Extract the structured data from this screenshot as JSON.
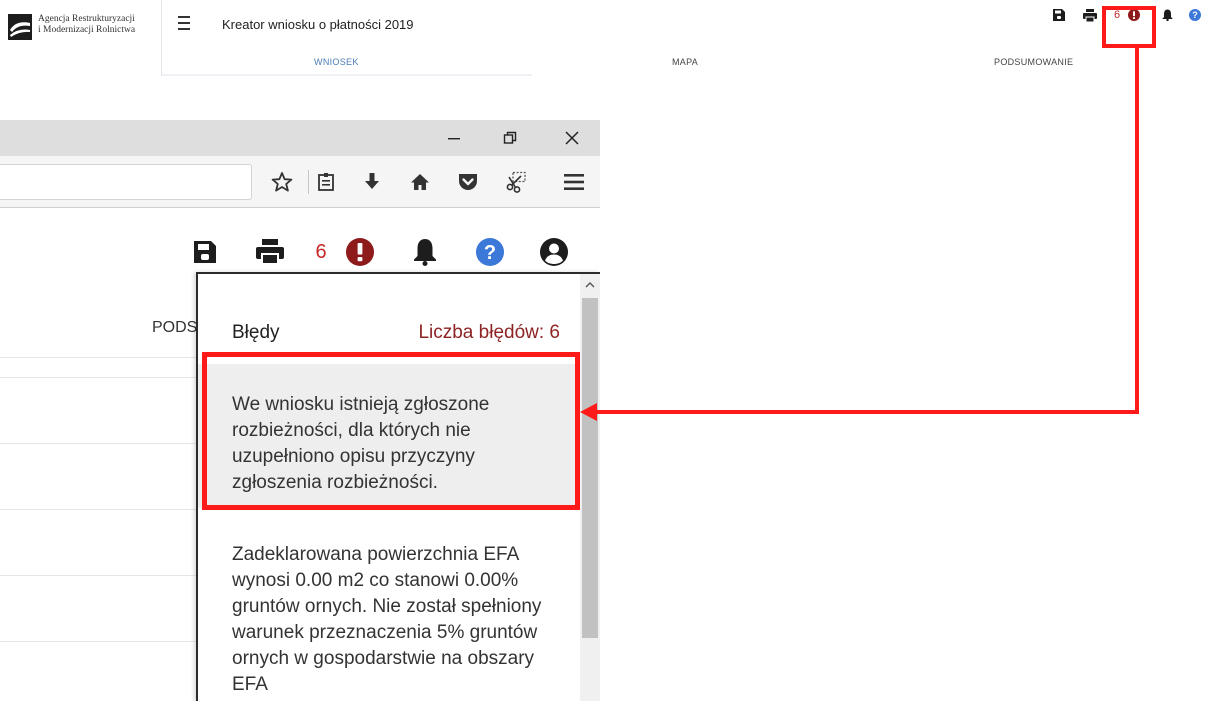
{
  "header": {
    "logo_line1": "Agencja Restrukturyzacji",
    "logo_line2": "i Modernizacji Rolnictwa",
    "title": "Kreator wniosku o płatności 2019",
    "error_count": "6",
    "tabs": [
      {
        "label": "WNIOSEK",
        "active": true
      },
      {
        "label": "MAPA",
        "active": false
      },
      {
        "label": "PODSUMOWANIE",
        "active": false
      }
    ]
  },
  "zoom": {
    "error_count": "6",
    "tab_partial": "PODS",
    "panel": {
      "title": "Błędy",
      "count_label": "Liczba błędów: 6",
      "errors": [
        "We wniosku istnieją zgłoszone rozbieżności, dla których nie uzupełniono opisu przyczyny zgłoszenia rozbieżności.",
        "Zadeklarowana powierzchnia EFA wynosi 0.00 m2 co stanowi 0.00% gruntów ornych. Nie został spełniony warunek przeznaczenia 5% gruntów ornych w gospodarstwie na obszary EFA"
      ]
    }
  },
  "colors": {
    "error_red": "#c62828",
    "highlight": "#ff1a1a",
    "tab_active": "#4a7db5",
    "help_blue": "#3b78d8"
  }
}
